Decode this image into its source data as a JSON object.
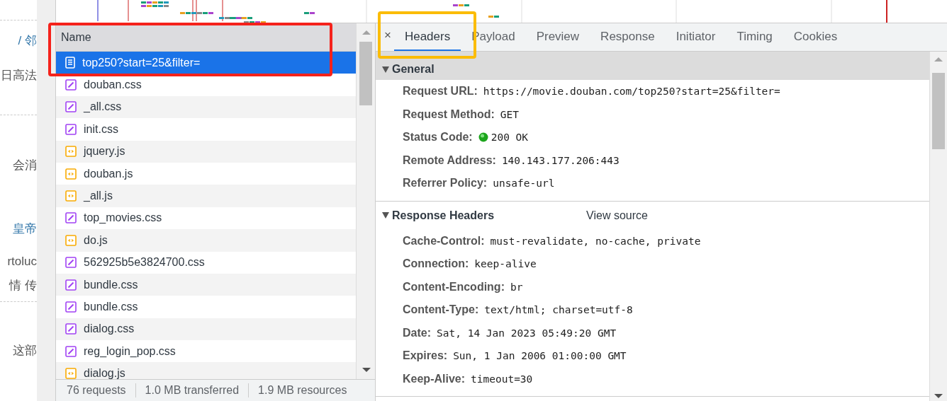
{
  "page_behind": {
    "texts": [
      "/ 邻",
      "日高法",
      "会消",
      "皇帝",
      "rtoluc",
      "情 传",
      "这部"
    ]
  },
  "requests": {
    "column": "Name",
    "rows": [
      {
        "name": "top250?start=25&filter=",
        "kind": "document",
        "selected": true
      },
      {
        "name": "douban.css",
        "kind": "css",
        "selected": false
      },
      {
        "name": "_all.css",
        "kind": "css",
        "selected": false
      },
      {
        "name": "init.css",
        "kind": "css",
        "selected": false
      },
      {
        "name": "jquery.js",
        "kind": "js",
        "selected": false
      },
      {
        "name": "douban.js",
        "kind": "js",
        "selected": false
      },
      {
        "name": "_all.js",
        "kind": "js",
        "selected": false
      },
      {
        "name": "top_movies.css",
        "kind": "css",
        "selected": false
      },
      {
        "name": "do.js",
        "kind": "js",
        "selected": false
      },
      {
        "name": "562925b5e3824700.css",
        "kind": "css",
        "selected": false
      },
      {
        "name": "bundle.css",
        "kind": "css",
        "selected": false
      },
      {
        "name": "bundle.css",
        "kind": "css",
        "selected": false
      },
      {
        "name": "dialog.css",
        "kind": "css",
        "selected": false
      },
      {
        "name": "reg_login_pop.css",
        "kind": "css",
        "selected": false
      },
      {
        "name": "dialog.js",
        "kind": "js",
        "selected": false
      }
    ]
  },
  "summary": [
    "76 requests",
    "1.0 MB transferred",
    "1.9 MB resources"
  ],
  "close": "×",
  "tabs": [
    {
      "label": "Headers",
      "selected": true
    },
    {
      "label": "Payload",
      "selected": false
    },
    {
      "label": "Preview",
      "selected": false
    },
    {
      "label": "Response",
      "selected": false
    },
    {
      "label": "Initiator",
      "selected": false
    },
    {
      "label": "Timing",
      "selected": false
    },
    {
      "label": "Cookies",
      "selected": false
    }
  ],
  "sections": [
    {
      "title": "General",
      "expanded": true,
      "fields": [
        {
          "name": "Request URL:",
          "value": "https://movie.douban.com/top250?start=25&filter="
        },
        {
          "name": "Request Method:",
          "value": "GET"
        },
        {
          "name": "Status Code:",
          "value": "200 OK",
          "kind": "status"
        },
        {
          "name": "Remote Address:",
          "value": "140.143.177.206:443"
        },
        {
          "name": "Referrer Policy:",
          "value": "unsafe-url"
        }
      ]
    },
    {
      "title": "Response Headers",
      "expanded": true,
      "action": "View source",
      "fields": [
        {
          "name": "Cache-Control:",
          "value": "must-revalidate, no-cache, private"
        },
        {
          "name": "Connection:",
          "value": "keep-alive"
        },
        {
          "name": "Content-Encoding:",
          "value": "br"
        },
        {
          "name": "Content-Type:",
          "value": "text/html; charset=utf-8"
        },
        {
          "name": "Date:",
          "value": "Sat, 14 Jan 2023 05:49:20 GMT"
        },
        {
          "name": "Expires:",
          "value": "Sun, 1 Jan 2006 01:00:00 GMT"
        },
        {
          "name": "Keep-Alive:",
          "value": "timeout=30"
        }
      ]
    }
  ]
}
